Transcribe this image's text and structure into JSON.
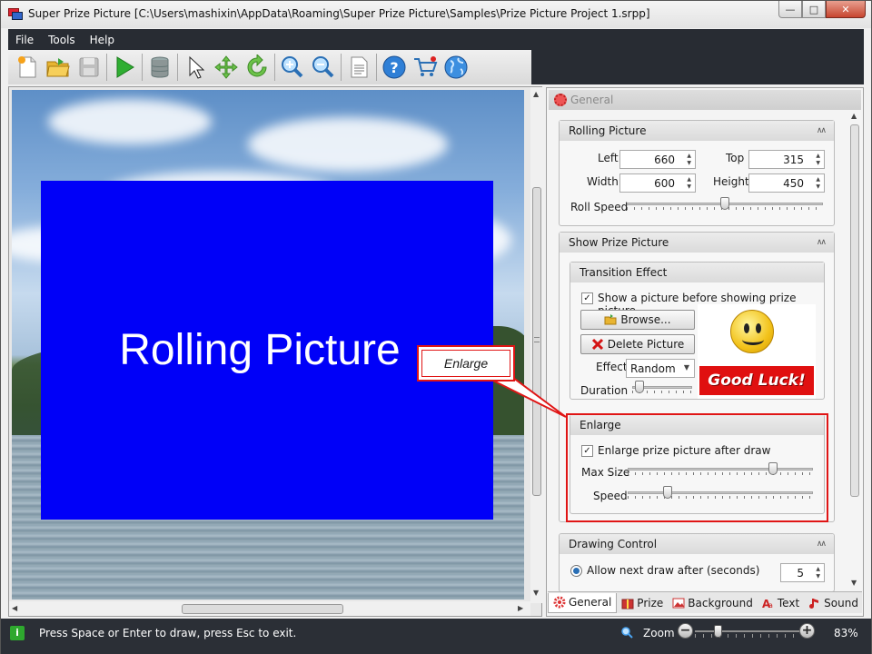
{
  "window": {
    "title": "Super Prize Picture [C:\\Users\\mashixin\\AppData\\Roaming\\Super Prize Picture\\Samples\\Prize Picture Project 1.srpp]",
    "min": "—",
    "max": "□",
    "close": "✕"
  },
  "menu": {
    "file": "File",
    "tools": "Tools",
    "help": "Help"
  },
  "canvas": {
    "rolling_text": "Rolling Picture",
    "rect_color": "#0000f8"
  },
  "callout": {
    "text": "Enlarge",
    "color": "#e01515"
  },
  "panel": {
    "header": "General",
    "rolling": {
      "title": "Rolling Picture",
      "left_label": "Left",
      "left_value": "660",
      "top_label": "Top",
      "top_value": "315",
      "width_label": "Width",
      "width_value": "600",
      "height_label": "Height",
      "height_value": "450",
      "speed_label": "Roll Speed"
    },
    "show": {
      "title": "Show Prize Picture",
      "transition_title": "Transition Effect",
      "show_before_label": "Show a picture before showing prize picture",
      "browse": "Browse...",
      "delete": "Delete Picture",
      "effect_label": "Effect",
      "effect_value": "Random",
      "duration_label": "Duration",
      "good_luck": "Good Luck!"
    },
    "enlarge": {
      "title": "Enlarge",
      "after_draw_label": "Enlarge prize picture after draw",
      "max_size_label": "Max Size",
      "speed_label": "Speed"
    },
    "drawing": {
      "title": "Drawing Control",
      "allow_next_label": "Allow next draw after (seconds)",
      "allow_next_value": "5"
    },
    "tabs": [
      "General",
      "Prize",
      "Background",
      "Text",
      "Sound"
    ]
  },
  "status": {
    "icon": "i",
    "message": "Press Space or Enter to draw, press Esc to exit.",
    "zoom_label": "Zoom",
    "zoom_minus": "−",
    "zoom_plus": "+",
    "zoom_value": "83%"
  },
  "sliders": {
    "roll_speed": 0.5,
    "duration": 0.05,
    "max_size": 0.8,
    "enlarge_speed": 0.2,
    "zoom": 0.2
  },
  "icons": [
    "new-file-icon",
    "open-folder-icon",
    "save-icon",
    "play-icon",
    "database-icon",
    "pointer-icon",
    "move-icon",
    "rotate-icon",
    "zoom-in-icon",
    "zoom-out-icon",
    "document-icon",
    "help-icon",
    "cart-icon",
    "globe-icon"
  ]
}
